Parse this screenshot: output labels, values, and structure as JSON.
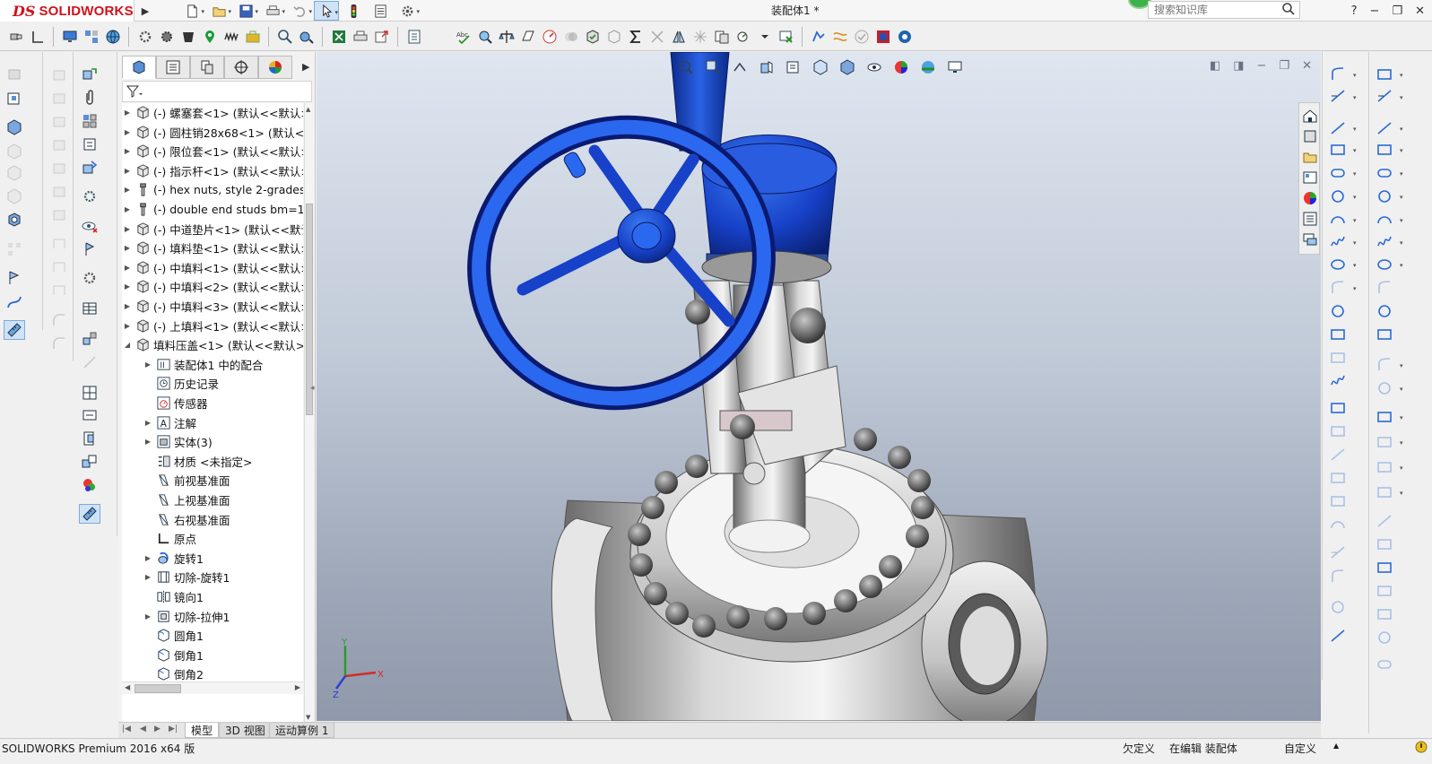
{
  "app": {
    "brand_ds": "DS",
    "brand_name": "SOLIDWORKS",
    "document_title": "装配体1 *",
    "search_placeholder": "搜索知识库"
  },
  "colors": {
    "accent_red": "#d0121b",
    "viewport_top": "#dfe6f0",
    "viewport_bottom": "#8f99aa",
    "handwheel_blue": "#1f4fd6",
    "selection_blue": "#cfe3f7"
  },
  "feature_manager": {
    "tabs": [
      "feature-manager-tab",
      "property-manager-tab",
      "configuration-manager-tab",
      "dimxpert-tab",
      "display-manager-tab"
    ],
    "tree": [
      {
        "level": 0,
        "arrow": "right",
        "icon": "part",
        "label": "(-) 螺塞套<1> (默认<<默认>_"
      },
      {
        "level": 0,
        "arrow": "right",
        "icon": "part",
        "label": "(-) 圆柱销28x68<1> (默认<<"
      },
      {
        "level": 0,
        "arrow": "right",
        "icon": "part",
        "label": "(-) 限位套<1> (默认<<默认>_"
      },
      {
        "level": 0,
        "arrow": "right",
        "icon": "part",
        "label": "(-) 指示杆<1> (默认<<默认>_"
      },
      {
        "level": 0,
        "arrow": "right",
        "icon": "fastener",
        "label": "(-) hex nuts, style 2-grades"
      },
      {
        "level": 0,
        "arrow": "right",
        "icon": "fastener",
        "label": "(-) double end studs bm=1."
      },
      {
        "level": 0,
        "arrow": "right",
        "icon": "part",
        "label": "(-) 中道垫片<1> (默认<<默认"
      },
      {
        "level": 0,
        "arrow": "right",
        "icon": "part",
        "label": "(-) 填料垫<1> (默认<<默认>_"
      },
      {
        "level": 0,
        "arrow": "right",
        "icon": "part",
        "label": "(-) 中填料<1> (默认<<默认>_"
      },
      {
        "level": 0,
        "arrow": "right",
        "icon": "part",
        "label": "(-) 中填料<2> (默认<<默认>_"
      },
      {
        "level": 0,
        "arrow": "right",
        "icon": "part",
        "label": "(-) 中填料<3> (默认<<默认>_"
      },
      {
        "level": 0,
        "arrow": "right",
        "icon": "part",
        "label": "(-) 上填料<1> (默认<<默认>_"
      },
      {
        "level": 0,
        "arrow": "down",
        "icon": "part",
        "label": "填料压盖<1> (默认<<默认>_"
      },
      {
        "level": 1,
        "arrow": "right",
        "icon": "mates",
        "label": "装配体1 中的配合"
      },
      {
        "level": 1,
        "arrow": "none",
        "icon": "history",
        "label": "历史记录"
      },
      {
        "level": 1,
        "arrow": "none",
        "icon": "sensor",
        "label": "传感器"
      },
      {
        "level": 1,
        "arrow": "right",
        "icon": "annotation",
        "label": "注解"
      },
      {
        "level": 1,
        "arrow": "right",
        "icon": "solid",
        "label": "实体(3)"
      },
      {
        "level": 1,
        "arrow": "none",
        "icon": "material",
        "label": "材质 <未指定>"
      },
      {
        "level": 1,
        "arrow": "none",
        "icon": "plane",
        "label": "前视基准面"
      },
      {
        "level": 1,
        "arrow": "none",
        "icon": "plane",
        "label": "上视基准面"
      },
      {
        "level": 1,
        "arrow": "none",
        "icon": "plane",
        "label": "右视基准面"
      },
      {
        "level": 1,
        "arrow": "none",
        "icon": "origin",
        "label": "原点"
      },
      {
        "level": 1,
        "arrow": "right",
        "icon": "revolve",
        "label": "旋转1"
      },
      {
        "level": 1,
        "arrow": "right",
        "icon": "cut-revolve",
        "label": "切除-旋转1"
      },
      {
        "level": 1,
        "arrow": "none",
        "icon": "mirror",
        "label": "镜向1"
      },
      {
        "level": 1,
        "arrow": "right",
        "icon": "cut-extrude",
        "label": "切除-拉伸1"
      },
      {
        "level": 1,
        "arrow": "none",
        "icon": "fillet",
        "label": "圆角1"
      },
      {
        "level": 1,
        "arrow": "none",
        "icon": "chamfer",
        "label": "倒角1"
      },
      {
        "level": 1,
        "arrow": "none",
        "icon": "chamfer",
        "label": "倒角2"
      }
    ]
  },
  "bottom_tabs": {
    "model": "模型",
    "view3d": "3D 视图",
    "motion": "运动算例 1"
  },
  "status": {
    "left": "SOLIDWORKS Premium 2016 x64 版",
    "underdefined": "欠定义",
    "editing": "在编辑 装配体",
    "custom": "自定义"
  },
  "axes": {
    "x": "X",
    "y": "Y",
    "z": "Z"
  }
}
